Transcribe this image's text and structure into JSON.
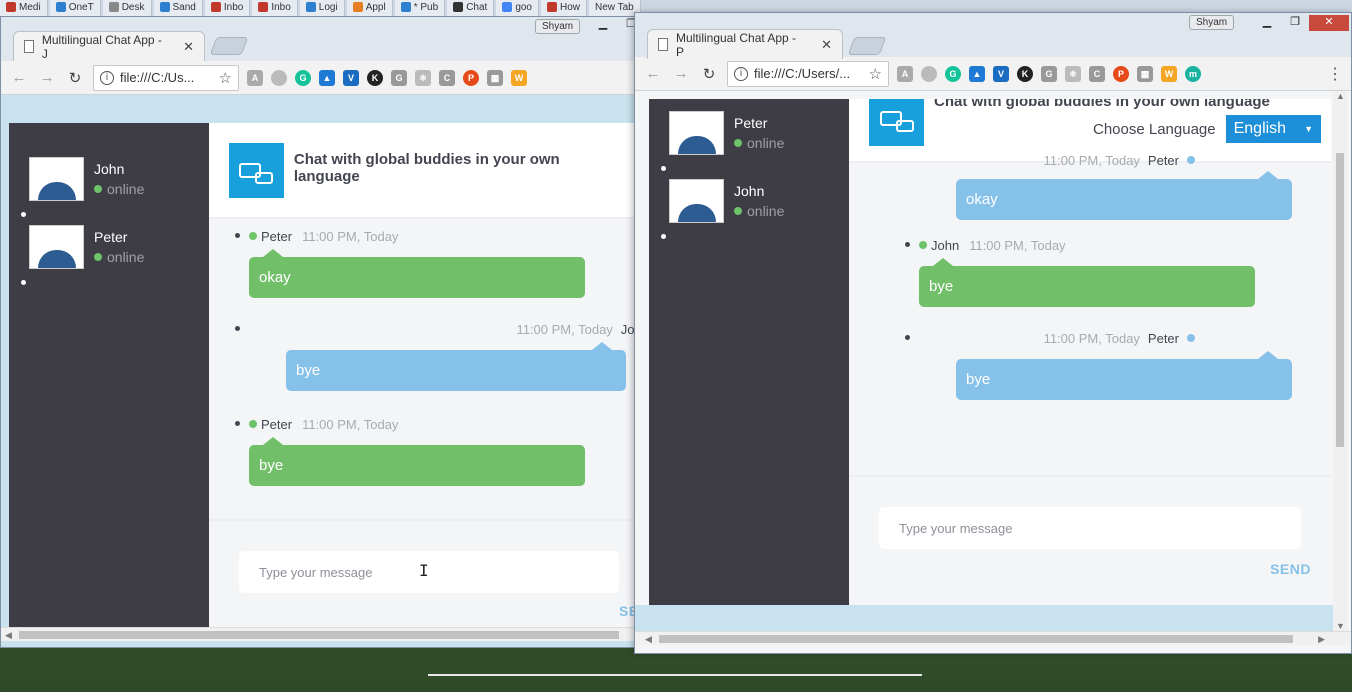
{
  "os_tabs": [
    "Medi",
    "OneT",
    "Desk",
    "Sand",
    "Inbo",
    "Inbo",
    "Logi",
    "Appl",
    "* Pub",
    "Chat",
    "goo",
    "How",
    "New Tab"
  ],
  "colors": {
    "sidebar": "#3e3c45",
    "green": "#72bf6a",
    "blue": "#86c1ea",
    "accent": "#18a0dc",
    "select": "#1d8ed8"
  },
  "left_window": {
    "user_badge": "Shyam",
    "tab_title": "Multilingual Chat App - J",
    "url": "file:///C:/Us...",
    "contacts": [
      {
        "name": "John",
        "status": "online"
      },
      {
        "name": "Peter",
        "status": "online"
      }
    ],
    "header_title": "Chat with global buddies in your own language",
    "messages": [
      {
        "sender": "Peter",
        "time": "11:00 PM, Today",
        "text": "okay"
      },
      {
        "sender": "John",
        "time": "11:00 PM, Today",
        "text": "bye"
      },
      {
        "sender": "Peter",
        "time": "11:00 PM, Today",
        "text": "bye"
      }
    ],
    "input_placeholder": "Type your message",
    "send_label": "SE"
  },
  "right_window": {
    "user_badge": "Shyam",
    "tab_title": "Multilingual Chat App - P",
    "url": "file:///C:/Users/...",
    "contacts": [
      {
        "name": "Peter",
        "status": "online"
      },
      {
        "name": "John",
        "status": "online"
      }
    ],
    "header_title": "Chat with global buddies in your own language",
    "choose_language_label": "Choose Language",
    "selected_language": "English",
    "messages": [
      {
        "sender": "Peter",
        "time": "11:00 PM, Today",
        "text": "okay"
      },
      {
        "sender": "John",
        "time": "11:00 PM, Today",
        "text": "bye"
      },
      {
        "sender": "Peter",
        "time": "11:00 PM, Today",
        "text": "bye"
      }
    ],
    "input_placeholder": "Type your message",
    "send_label": "SEND"
  }
}
